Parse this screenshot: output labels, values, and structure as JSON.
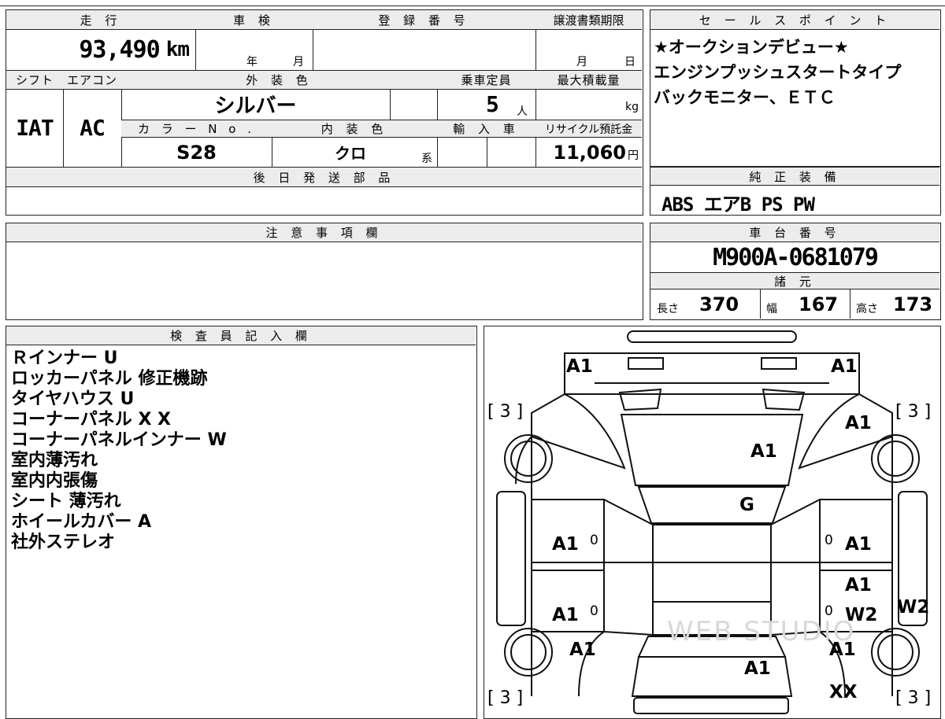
{
  "vehicle": {
    "mileage_header": "走 行",
    "mileage": "93,490",
    "mileage_unit": "km",
    "inspection_header": "車 検",
    "inspection_year_unit": "年",
    "inspection_month_unit": "月",
    "registration_header": "登 録 番 号",
    "transfer_header": "譲渡書類期限",
    "transfer_month_unit": "月",
    "transfer_day_unit": "日",
    "shift_header": "シフト",
    "shift": "IAT",
    "ac_header": "エアコン",
    "ac": "AC",
    "exterior_header": "外 装 色",
    "exterior_color": "シルバー",
    "capacity_header": "乗車定員",
    "capacity": "5",
    "capacity_unit": "人",
    "max_load_header": "最大積載量",
    "max_load_unit": "kg",
    "color_no_header": "カ ラ ー N o .",
    "color_no": "S28",
    "interior_header": "内 装 色",
    "interior_color": "クロ",
    "interior_suffix": "系",
    "import_header": "輸 入 車",
    "recycle_header": "リサイクル預託金",
    "recycle_fee": "11,060",
    "recycle_unit": "円",
    "later_parts_header": "後 日 発 送 部 品"
  },
  "sales_point": {
    "header": "セ ー ル ス ポ イ ン ト",
    "lines": [
      "★オークションデビュー★",
      "エンジンプッシュスタートタイプ",
      "バックモニター、ＥＴＣ"
    ]
  },
  "equipment": {
    "header": "純 正 装 備",
    "value": "ABS エアB PS PW"
  },
  "caution": {
    "header": "注 意 事 項 欄"
  },
  "chassis": {
    "header": "車 台 番 号",
    "number": "M900A-0681079",
    "spec_header": "諸 元",
    "length_label": "長さ",
    "length": "370",
    "width_label": "幅",
    "width": "167",
    "height_label": "高さ",
    "height": "173"
  },
  "inspector": {
    "header": "検 査 員 記 入 欄",
    "notes": [
      "Ｒインナー U",
      "ロッカーパネル 修正機跡",
      "タイヤハウス U",
      "コーナーパネル X X",
      "コーナーパネルインナー W",
      "室内薄汚れ",
      "室内内張傷",
      "シート 薄汚れ",
      "ホイールカバー A",
      "社外ステレオ"
    ]
  },
  "diagram": {
    "tire_tl": "[ 3 ]",
    "tire_tr": "[ 3 ]",
    "tire_bl": "[ 3 ]",
    "tire_br": "[ 3 ]",
    "front_left_corner": "A1",
    "front_right_corner": "A1",
    "right_front_fender": "A1",
    "hood": "A1",
    "windshield": "G",
    "left_front_door": "A1",
    "left_front_door_mark": "0",
    "right_front_door_mark": "0",
    "right_front_door": "A1",
    "left_rear_door": "A1",
    "left_rear_door_mark": "0",
    "right_rear_door_a": "A1",
    "right_rear_door_mark": "0",
    "right_rear_door_b": "W2",
    "right_rocker": "W2",
    "left_rear_fender": "A1",
    "right_rear_fender": "A1",
    "rear_gate": "A1",
    "right_rear_corner": "XX",
    "watermark": "WEB STUDIO"
  }
}
